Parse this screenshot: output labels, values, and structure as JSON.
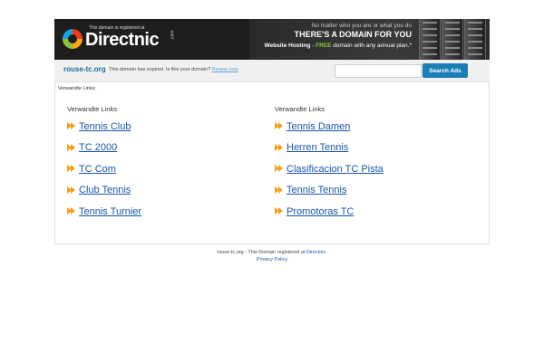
{
  "banner": {
    "registered": "This domain is registered at",
    "brand": "Directnic",
    "dotcom": ".com",
    "tagline1": "No matter who you are or what you do",
    "tagline2": "THERE'S A DOMAIN FOR YOU",
    "hosting_label": "Website Hosting",
    "hosting_sep": " - ",
    "free": "FREE",
    "hosting_rest": " domain with any annual plan.*"
  },
  "bar": {
    "domain": "rouse-tc.org",
    "expired": "This domain has expired. Is this your domain?",
    "renew": "Renew now",
    "search_button": "Search Ads"
  },
  "content": {
    "related_top": "Verwandte Links:",
    "left_heading": "Verwandte Links",
    "right_heading": "Verwandte Links",
    "left_links": [
      "Tennis Club",
      "TC 2000",
      "TC Com",
      "Club Tennis",
      "Tennis Turnier"
    ],
    "right_links": [
      "Tennis Damen",
      "Herren Tennis",
      "Clasificacion TC Pista",
      "Tennis Tennis",
      "Promotoras TC"
    ]
  },
  "footer": {
    "line1_prefix": "rouse-tc.org - This Domain registered at ",
    "line1_link": "Directnic",
    "line1_suffix": ".",
    "privacy": "Privacy Policy"
  },
  "colors": {
    "accent": "#1a7fb5",
    "link": "#1a55a6",
    "arrow": "#f0a020"
  }
}
